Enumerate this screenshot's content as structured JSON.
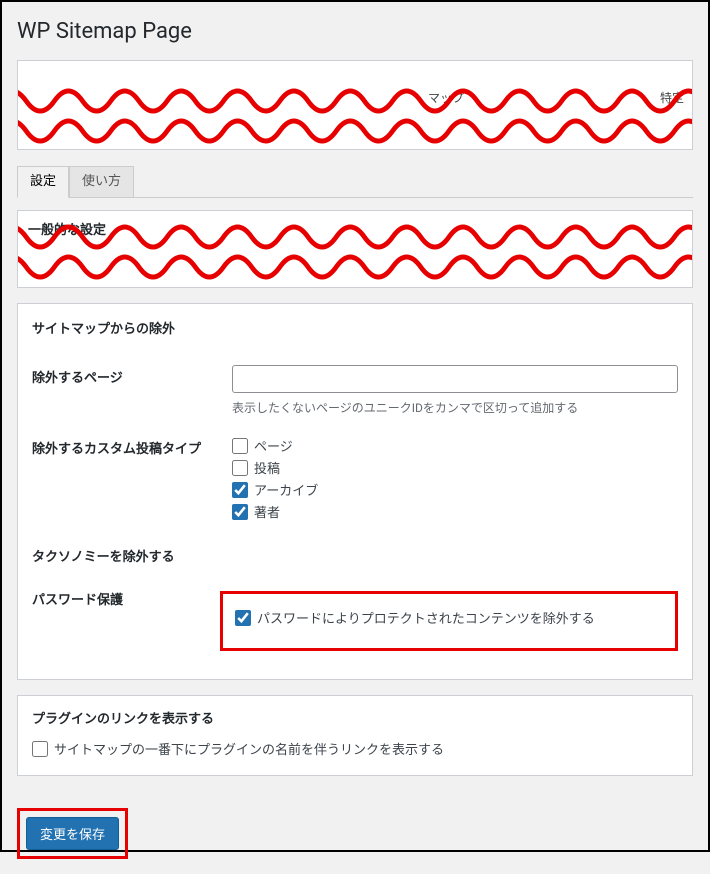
{
  "page": {
    "title": "WP Sitemap Page"
  },
  "peek": {
    "text1": "マップ",
    "text2": "特定"
  },
  "tabs": {
    "settings": "設定",
    "howto": "使い方"
  },
  "general": {
    "heading": "一般的な設定"
  },
  "exclusion": {
    "heading": "サイトマップからの除外",
    "exclude_pages_label": "除外するページ",
    "exclude_pages_value": "",
    "exclude_pages_desc": "表示したくないページのユニークIDをカンマで区切って追加する",
    "exclude_cpt_label": "除外するカスタム投稿タイプ",
    "cpt": {
      "page": "ページ",
      "post": "投稿",
      "archive": "アーカイブ",
      "author": "著者"
    },
    "exclude_taxonomy_label": "タクソノミーを除外する",
    "password_label": "パスワード保護",
    "password_checkbox": "パスワードによりプロテクトされたコンテンツを除外する"
  },
  "plugin_link": {
    "heading": "プラグインのリンクを表示する",
    "checkbox_label": "サイトマップの一番下にプラグインの名前を伴うリンクを表示する"
  },
  "submit": {
    "label": "変更を保存"
  }
}
